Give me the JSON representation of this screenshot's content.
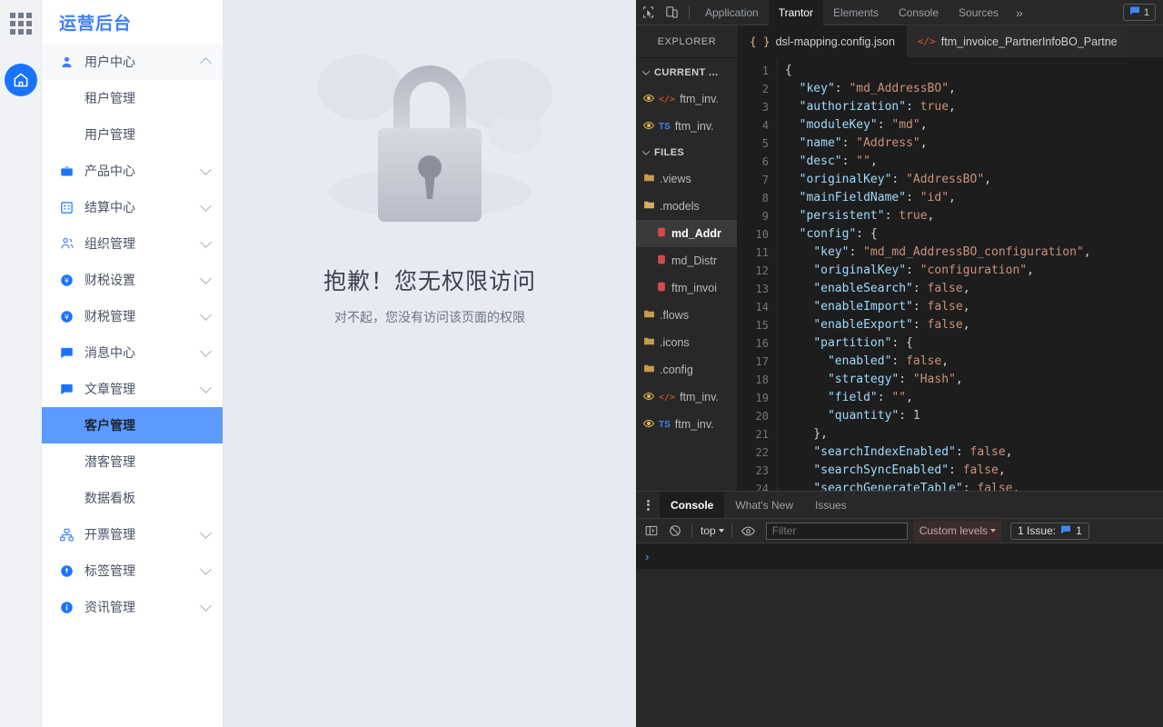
{
  "app": {
    "brand": "运营后台",
    "rail": {
      "launcher_icon": "grid-apps-icon",
      "home_icon": "home-icon"
    },
    "menu": [
      {
        "label": "用户中心",
        "icon": "user-icon",
        "expanded": true,
        "chevron": "chevron-up-icon",
        "children": [
          {
            "label": "租户管理",
            "active": false
          },
          {
            "label": "用户管理",
            "active": false
          }
        ]
      },
      {
        "label": "产品中心",
        "icon": "briefcase-icon",
        "expanded": false,
        "chevron": "chevron-down-icon",
        "children": []
      },
      {
        "label": "结算中心",
        "icon": "calculator-icon",
        "expanded": false,
        "chevron": "chevron-down-icon",
        "children": []
      },
      {
        "label": "组织管理",
        "icon": "people-icon",
        "expanded": false,
        "chevron": "chevron-down-icon",
        "children": []
      },
      {
        "label": "财税设置",
        "icon": "yen-circle-icon",
        "expanded": false,
        "chevron": "chevron-down-icon",
        "children": []
      },
      {
        "label": "财税管理",
        "icon": "yen-circle-icon",
        "expanded": false,
        "chevron": "chevron-down-icon",
        "children": []
      },
      {
        "label": "消息中心",
        "icon": "message-icon",
        "expanded": false,
        "chevron": "chevron-down-icon",
        "children": []
      },
      {
        "label": "文章管理",
        "icon": "message-icon",
        "expanded": true,
        "chevron": "chevron-down-icon",
        "children": [
          {
            "label": "客户管理",
            "active": true
          },
          {
            "label": "潜客管理",
            "active": false
          },
          {
            "label": "数据看板",
            "active": false
          }
        ]
      },
      {
        "label": "开票管理",
        "icon": "sitemap-icon",
        "expanded": false,
        "chevron": "chevron-down-icon",
        "children": []
      },
      {
        "label": "标签管理",
        "icon": "tag-circle-icon",
        "expanded": false,
        "chevron": "chevron-down-icon",
        "children": []
      },
      {
        "label": "资讯管理",
        "icon": "info-circle-icon",
        "expanded": false,
        "chevron": "chevron-down-icon",
        "children": []
      }
    ],
    "error": {
      "illustration": "locked-padlock-illustration",
      "title": "抱歉！您无权限访问",
      "subtitle": "对不起，您没有访问该页面的权限"
    }
  },
  "devtools": {
    "toolbar": {
      "inspect_icon": "inspect-cursor-icon",
      "device_icon": "device-toolbar-icon",
      "more_label": "»",
      "issue_badge": {
        "icon": "issue-message-icon",
        "count": "1"
      }
    },
    "tabs": [
      {
        "label": "Application",
        "active": false
      },
      {
        "label": "Trantor",
        "active": true
      },
      {
        "label": "Elements",
        "active": false
      },
      {
        "label": "Console",
        "active": false
      },
      {
        "label": "Sources",
        "active": false
      }
    ],
    "explorer_label": "EXPLORER",
    "file_tabs": [
      {
        "label": "dsl-mapping.config.json",
        "icon": "json-braces-icon",
        "active": true
      },
      {
        "label": "ftm_invoice_PartnerInfoBO_Partne",
        "icon": "code-tag-icon",
        "active": false
      }
    ],
    "tree": [
      {
        "type": "section",
        "label": "CURRENT ...",
        "twisty": "chevron-down-icon"
      },
      {
        "type": "file",
        "label": "ftm_inv.",
        "icons": [
          "eye-icon",
          "code-tag-icon"
        ],
        "indent": false,
        "selected": false
      },
      {
        "type": "file",
        "label": "ftm_inv.",
        "icons": [
          "eye-icon",
          "typescript-icon"
        ],
        "indent": false,
        "selected": false
      },
      {
        "type": "section",
        "label": "FILES",
        "twisty": "chevron-down-icon"
      },
      {
        "type": "folder",
        "label": ".views",
        "icons": [
          "folder-icon"
        ],
        "indent": false,
        "selected": false
      },
      {
        "type": "folder",
        "label": ".models",
        "icons": [
          "folder-open-icon"
        ],
        "indent": false,
        "selected": false
      },
      {
        "type": "model",
        "label": "md_Addr",
        "icons": [
          "database-icon"
        ],
        "indent": true,
        "selected": true
      },
      {
        "type": "model",
        "label": "md_Distr",
        "icons": [
          "database-icon"
        ],
        "indent": true,
        "selected": false
      },
      {
        "type": "model",
        "label": "ftm_invoi",
        "icons": [
          "database-icon"
        ],
        "indent": true,
        "selected": false
      },
      {
        "type": "folder",
        "label": ".flows",
        "icons": [
          "folder-icon"
        ],
        "indent": false,
        "selected": false
      },
      {
        "type": "folder",
        "label": ".icons",
        "icons": [
          "folder-icon"
        ],
        "indent": false,
        "selected": false
      },
      {
        "type": "folder",
        "label": ".config",
        "icons": [
          "folder-icon"
        ],
        "indent": false,
        "selected": false
      },
      {
        "type": "file",
        "label": "ftm_inv.",
        "icons": [
          "eye-icon",
          "code-tag-icon"
        ],
        "indent": false,
        "selected": false
      },
      {
        "type": "file",
        "label": "ftm_inv.",
        "icons": [
          "eye-icon",
          "typescript-icon"
        ],
        "indent": false,
        "selected": false
      }
    ],
    "editor": {
      "first_line": 1,
      "lines": [
        {
          "n": 1,
          "tokens": [
            {
              "t": "p",
              "v": "{"
            }
          ]
        },
        {
          "n": 2,
          "tokens": [
            {
              "t": "p",
              "v": "  "
            },
            {
              "t": "k",
              "v": "\"key\""
            },
            {
              "t": "p",
              "v": ": "
            },
            {
              "t": "s",
              "v": "\"md_AddressBO\""
            },
            {
              "t": "p",
              "v": ","
            }
          ]
        },
        {
          "n": 3,
          "tokens": [
            {
              "t": "p",
              "v": "  "
            },
            {
              "t": "k",
              "v": "\"authorization\""
            },
            {
              "t": "p",
              "v": ": "
            },
            {
              "t": "b",
              "v": "true"
            },
            {
              "t": "p",
              "v": ","
            }
          ]
        },
        {
          "n": 4,
          "tokens": [
            {
              "t": "p",
              "v": "  "
            },
            {
              "t": "k",
              "v": "\"moduleKey\""
            },
            {
              "t": "p",
              "v": ": "
            },
            {
              "t": "s",
              "v": "\"md\""
            },
            {
              "t": "p",
              "v": ","
            }
          ]
        },
        {
          "n": 5,
          "tokens": [
            {
              "t": "p",
              "v": "  "
            },
            {
              "t": "k",
              "v": "\"name\""
            },
            {
              "t": "p",
              "v": ": "
            },
            {
              "t": "s",
              "v": "\"Address\""
            },
            {
              "t": "p",
              "v": ","
            }
          ]
        },
        {
          "n": 6,
          "tokens": [
            {
              "t": "p",
              "v": "  "
            },
            {
              "t": "k",
              "v": "\"desc\""
            },
            {
              "t": "p",
              "v": ": "
            },
            {
              "t": "s",
              "v": "\"\""
            },
            {
              "t": "p",
              "v": ","
            }
          ]
        },
        {
          "n": 7,
          "tokens": [
            {
              "t": "p",
              "v": "  "
            },
            {
              "t": "k",
              "v": "\"originalKey\""
            },
            {
              "t": "p",
              "v": ": "
            },
            {
              "t": "s",
              "v": "\"AddressBO\""
            },
            {
              "t": "p",
              "v": ","
            }
          ]
        },
        {
          "n": 8,
          "tokens": [
            {
              "t": "p",
              "v": "  "
            },
            {
              "t": "k",
              "v": "\"mainFieldName\""
            },
            {
              "t": "p",
              "v": ": "
            },
            {
              "t": "s",
              "v": "\"id\""
            },
            {
              "t": "p",
              "v": ","
            }
          ]
        },
        {
          "n": 9,
          "tokens": [
            {
              "t": "p",
              "v": "  "
            },
            {
              "t": "k",
              "v": "\"persistent\""
            },
            {
              "t": "p",
              "v": ": "
            },
            {
              "t": "b",
              "v": "true"
            },
            {
              "t": "p",
              "v": ","
            }
          ]
        },
        {
          "n": 10,
          "tokens": [
            {
              "t": "p",
              "v": "  "
            },
            {
              "t": "k",
              "v": "\"config\""
            },
            {
              "t": "p",
              "v": ": {"
            }
          ]
        },
        {
          "n": 11,
          "tokens": [
            {
              "t": "p",
              "v": "    "
            },
            {
              "t": "k",
              "v": "\"key\""
            },
            {
              "t": "p",
              "v": ": "
            },
            {
              "t": "s",
              "v": "\"md_md_AddressBO_configuration\""
            },
            {
              "t": "p",
              "v": ","
            }
          ]
        },
        {
          "n": 12,
          "tokens": [
            {
              "t": "p",
              "v": "    "
            },
            {
              "t": "k",
              "v": "\"originalKey\""
            },
            {
              "t": "p",
              "v": ": "
            },
            {
              "t": "s",
              "v": "\"configuration\""
            },
            {
              "t": "p",
              "v": ","
            }
          ]
        },
        {
          "n": 13,
          "tokens": [
            {
              "t": "p",
              "v": "    "
            },
            {
              "t": "k",
              "v": "\"enableSearch\""
            },
            {
              "t": "p",
              "v": ": "
            },
            {
              "t": "b",
              "v": "false"
            },
            {
              "t": "p",
              "v": ","
            }
          ]
        },
        {
          "n": 14,
          "tokens": [
            {
              "t": "p",
              "v": "    "
            },
            {
              "t": "k",
              "v": "\"enableImport\""
            },
            {
              "t": "p",
              "v": ": "
            },
            {
              "t": "b",
              "v": "false"
            },
            {
              "t": "p",
              "v": ","
            }
          ]
        },
        {
          "n": 15,
          "tokens": [
            {
              "t": "p",
              "v": "    "
            },
            {
              "t": "k",
              "v": "\"enableExport\""
            },
            {
              "t": "p",
              "v": ": "
            },
            {
              "t": "b",
              "v": "false"
            },
            {
              "t": "p",
              "v": ","
            }
          ]
        },
        {
          "n": 16,
          "tokens": [
            {
              "t": "p",
              "v": "    "
            },
            {
              "t": "k",
              "v": "\"partition\""
            },
            {
              "t": "p",
              "v": ": {"
            }
          ]
        },
        {
          "n": 17,
          "tokens": [
            {
              "t": "p",
              "v": "      "
            },
            {
              "t": "k",
              "v": "\"enabled\""
            },
            {
              "t": "p",
              "v": ": "
            },
            {
              "t": "b",
              "v": "false"
            },
            {
              "t": "p",
              "v": ","
            }
          ]
        },
        {
          "n": 18,
          "tokens": [
            {
              "t": "p",
              "v": "      "
            },
            {
              "t": "k",
              "v": "\"strategy\""
            },
            {
              "t": "p",
              "v": ": "
            },
            {
              "t": "s",
              "v": "\"Hash\""
            },
            {
              "t": "p",
              "v": ","
            }
          ]
        },
        {
          "n": 19,
          "tokens": [
            {
              "t": "p",
              "v": "      "
            },
            {
              "t": "k",
              "v": "\"field\""
            },
            {
              "t": "p",
              "v": ": "
            },
            {
              "t": "s",
              "v": "\"\""
            },
            {
              "t": "p",
              "v": ","
            }
          ]
        },
        {
          "n": 20,
          "tokens": [
            {
              "t": "p",
              "v": "      "
            },
            {
              "t": "k",
              "v": "\"quantity\""
            },
            {
              "t": "p",
              "v": ": "
            },
            {
              "t": "n",
              "v": "1"
            }
          ]
        },
        {
          "n": 21,
          "tokens": [
            {
              "t": "p",
              "v": "    },"
            }
          ]
        },
        {
          "n": 22,
          "tokens": [
            {
              "t": "p",
              "v": "    "
            },
            {
              "t": "k",
              "v": "\"searchIndexEnabled\""
            },
            {
              "t": "p",
              "v": ": "
            },
            {
              "t": "b",
              "v": "false"
            },
            {
              "t": "p",
              "v": ","
            }
          ]
        },
        {
          "n": 23,
          "tokens": [
            {
              "t": "p",
              "v": "    "
            },
            {
              "t": "k",
              "v": "\"searchSyncEnabled\""
            },
            {
              "t": "p",
              "v": ": "
            },
            {
              "t": "b",
              "v": "false"
            },
            {
              "t": "p",
              "v": ","
            }
          ]
        },
        {
          "n": 24,
          "tokens": [
            {
              "t": "p",
              "v": "    "
            },
            {
              "t": "k",
              "v": "\"searchGenerateTable\""
            },
            {
              "t": "p",
              "v": ": "
            },
            {
              "t": "b",
              "v": "false"
            },
            {
              "t": "p",
              "v": ","
            }
          ]
        }
      ]
    },
    "console": {
      "tabs": [
        {
          "label": "Console",
          "active": true
        },
        {
          "label": "What's New",
          "active": false
        },
        {
          "label": "Issues",
          "active": false
        }
      ],
      "sidebar_icon": "console-sidebar-icon",
      "clear_icon": "clear-console-icon",
      "context": "top",
      "eye_icon": "live-expression-icon",
      "filter_value": "",
      "filter_placeholder": "Filter",
      "levels_label": "Custom levels",
      "issue_label": "1 Issue:",
      "issue_count": "1",
      "prompt": "›"
    }
  },
  "colors": {
    "brand_blue": "#3d7eff",
    "accent_blue": "#1a73ff",
    "active_item": "#5b9bff",
    "content_bg": "#e8eaf2",
    "devtools_bg": "#282828",
    "editor_bg": "#1d1d1d"
  }
}
